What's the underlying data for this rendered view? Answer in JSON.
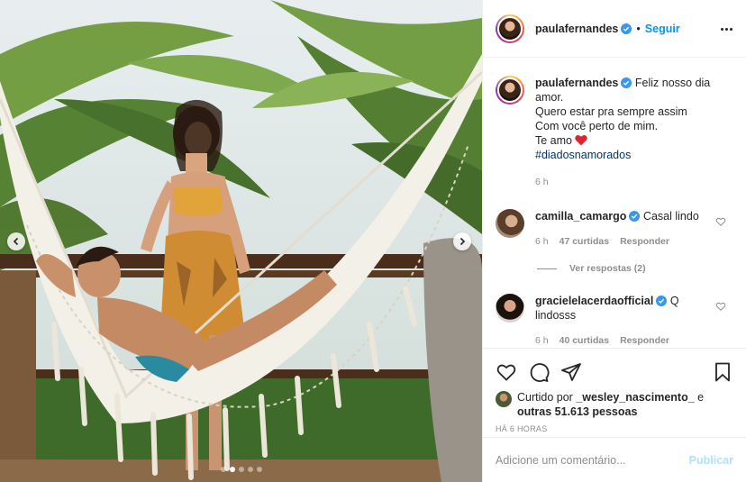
{
  "post": {
    "author": "paulafernandes",
    "follow_label": "Seguir",
    "separator": "•",
    "caption": {
      "username": "paulafernandes",
      "line1": "Feliz nosso dia amor.",
      "line2": "Quero estar pra sempre assim",
      "line3": "Com você perto de mim.",
      "line4": "Te amo",
      "emoji": "red-heart",
      "hashtag": "#diadosnamorados",
      "time": "6 h"
    },
    "comments": [
      {
        "username": "camilla_camargo",
        "text": "Casal lindo",
        "time": "6 h",
        "likes": "47 curtidas",
        "reply": "Responder"
      },
      {
        "username": "gracielelacerdaofficial",
        "text": "Q lindosss",
        "time": "6 h",
        "likes": "40 curtidas",
        "reply": "Responder"
      }
    ],
    "view_replies": "Ver respostas (2)",
    "liked_by": {
      "prefix": "Curtido por",
      "user": "_wesley_nascimento_",
      "middle": "e",
      "others": "outras 51.613 pessoas"
    },
    "posted_ago": "HÁ 6 HORAS",
    "comment_placeholder": "Adicione um comentário...",
    "publish_label": "Publicar",
    "carousel": {
      "count": 5,
      "active_index": 1
    }
  },
  "colors": {
    "link_blue": "#0095f6",
    "hashtag": "#00376b",
    "muted": "#8e8e8e",
    "publish_disabled": "#b2dffc",
    "heart_red": "#ed4956"
  },
  "icons": [
    "verified-badge-icon",
    "more-options-icon",
    "heart-icon",
    "comment-icon",
    "share-icon",
    "bookmark-icon",
    "chevron-left-icon",
    "chevron-right-icon"
  ]
}
